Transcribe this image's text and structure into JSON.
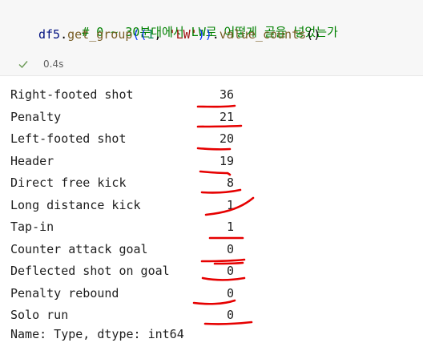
{
  "cell": {
    "comment": "# 0 ~ 30분대에서 LW로 어떻게 골을 넣었는가",
    "code": {
      "var": "df5",
      "dot1": ".",
      "method1": "get_group",
      "open_outer": "(",
      "open_inner": "(",
      "num": "1",
      "comma": ", ",
      "str": "'LW'",
      "close_inner": ")",
      "close_outer": ")",
      "dot2": ".",
      "method2": "value_counts",
      "call_parens": "()"
    },
    "exec_time": "0.4s",
    "status_icon": "check-icon"
  },
  "output": {
    "rows": [
      {
        "label": "Right-footed shot",
        "value": "36"
      },
      {
        "label": "Penalty",
        "value": "21"
      },
      {
        "label": "Left-footed shot",
        "value": "20"
      },
      {
        "label": "Header",
        "value": "19"
      },
      {
        "label": "Direct free kick",
        "value": "8"
      },
      {
        "label": "Long distance kick",
        "value": "1"
      },
      {
        "label": "Tap-in",
        "value": "1"
      },
      {
        "label": "Counter attack goal",
        "value": "0"
      },
      {
        "label": "Deflected shot on goal",
        "value": "0"
      },
      {
        "label": "Penalty rebound",
        "value": "0"
      },
      {
        "label": "Solo run",
        "value": "0"
      }
    ],
    "footer": "Name: Type, dtype: int64"
  },
  "colors": {
    "annotation": "#e60000",
    "comment": "#008000",
    "check": "#6a9955"
  }
}
